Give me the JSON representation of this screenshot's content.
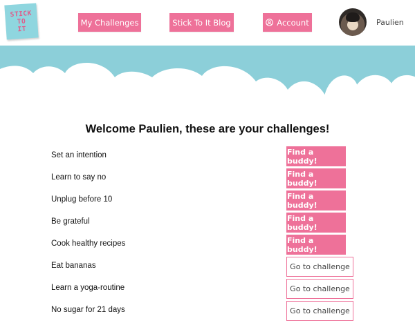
{
  "logo": {
    "lines": [
      "STICK",
      "TO",
      "IT"
    ]
  },
  "nav": {
    "challenges": "My Challenges",
    "blog": "Stick To It Blog",
    "account": "Account"
  },
  "user": {
    "name": "Paulien"
  },
  "welcome": "Welcome Paulien, these are your challenges!",
  "challenges": [
    {
      "title": "Set an intention",
      "action": "Find a buddy!"
    },
    {
      "title": "Learn to say no",
      "action": "Find a buddy!"
    },
    {
      "title": "Unplug before 10",
      "action": "Find a buddy!"
    },
    {
      "title": "Be grateful",
      "action": "Find a buddy!"
    },
    {
      "title": "Cook healthy recipes",
      "action": "Find a buddy!"
    },
    {
      "title": "Eat bananas",
      "action": "Go to challenge"
    },
    {
      "title": "Learn a yoga-routine",
      "action": "Go to challenge"
    },
    {
      "title": "No sugar for 21 days",
      "action": "Go to challenge"
    }
  ],
  "colors": {
    "accent": "#ee7199",
    "cloud": "#8ccfd9",
    "logo": "#8fd6df"
  },
  "icons": {
    "account": "user-circle-icon"
  }
}
